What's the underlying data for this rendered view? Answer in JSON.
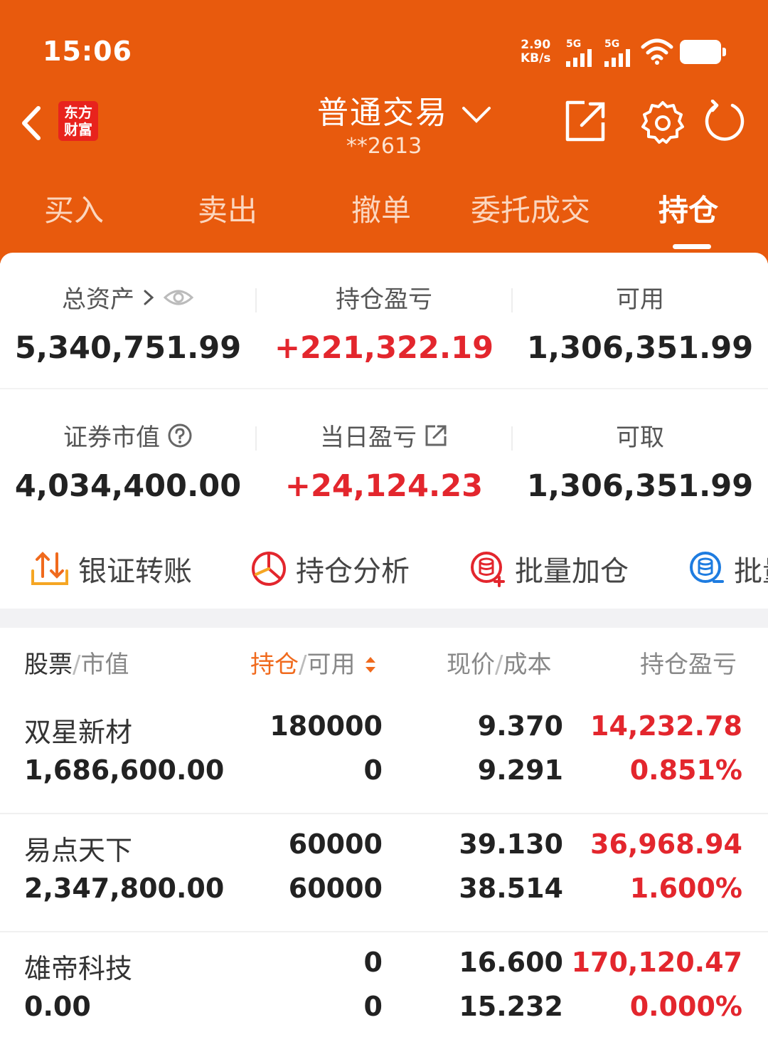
{
  "status_bar": {
    "time": "15:06",
    "net_speed_value": "2.90",
    "net_speed_unit": "KB/s",
    "signal1": "5G",
    "signal2": "5G"
  },
  "header": {
    "logo_line1": "东方",
    "logo_line2": "财富",
    "title": "普通交易",
    "account": "**2613",
    "icons": [
      "back-arrow-icon",
      "share-icon",
      "gear-icon",
      "refresh-icon"
    ]
  },
  "tabs": [
    {
      "label": "买入",
      "active": false
    },
    {
      "label": "卖出",
      "active": false
    },
    {
      "label": "撤单",
      "active": false
    },
    {
      "label": "委托成交",
      "active": false
    },
    {
      "label": "持仓",
      "active": true
    }
  ],
  "summary": {
    "total_assets": {
      "label": "总资产",
      "value": "5,340,751.99"
    },
    "position_pnl": {
      "label": "持仓盈亏",
      "value": "+221,322.19"
    },
    "available": {
      "label": "可用",
      "value": "1,306,351.99"
    },
    "market_value": {
      "label": "证券市值",
      "value": "4,034,400.00"
    },
    "daily_pnl": {
      "label": "当日盈亏",
      "value": "+24,124.23"
    },
    "withdrawable": {
      "label": "可取",
      "value": "1,306,351.99"
    }
  },
  "actions": [
    {
      "label": "银证转账",
      "icon": "transfer-icon"
    },
    {
      "label": "持仓分析",
      "icon": "pie-chart-icon"
    },
    {
      "label": "批量加仓",
      "icon": "batch-add-icon"
    },
    {
      "label": "批量",
      "icon": "batch-icon"
    }
  ],
  "table": {
    "headers": {
      "stock": "股票",
      "market_value": "市值",
      "position": "持仓",
      "available": "可用",
      "price": "现价",
      "cost": "成本",
      "pnl": "持仓盈亏"
    },
    "rows": [
      {
        "name": "双星新材",
        "market_value": "1,686,600.00",
        "position": "180000",
        "available": "0",
        "price": "9.370",
        "cost": "9.291",
        "pnl": "14,232.78",
        "pnl_pct": "0.851%"
      },
      {
        "name": "易点天下",
        "market_value": "2,347,800.00",
        "position": "60000",
        "available": "60000",
        "price": "39.130",
        "cost": "38.514",
        "pnl": "36,968.94",
        "pnl_pct": "1.600%"
      },
      {
        "name": "雄帝科技",
        "market_value": "0.00",
        "position": "0",
        "available": "0",
        "price": "16.600",
        "cost": "15.232",
        "pnl": "170,120.47",
        "pnl_pct": "0.000%"
      }
    ]
  },
  "colors": {
    "brand_orange": "#e85a0d",
    "profit_red": "#e3262d",
    "accent_orange": "#f06a1d"
  }
}
